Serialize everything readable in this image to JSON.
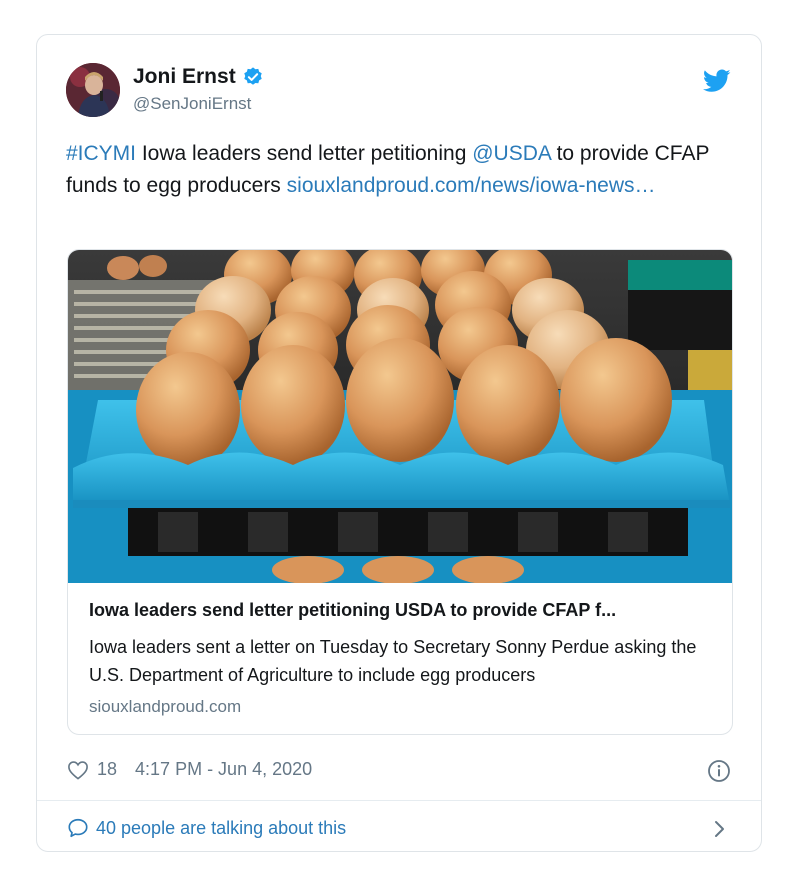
{
  "author": {
    "name": "Joni Ernst",
    "handle": "@SenJoniErnst",
    "verified": true
  },
  "tweet": {
    "parts": [
      {
        "text": "#ICYMI",
        "type": "hashtag"
      },
      {
        "text": " Iowa leaders send letter petitioning ",
        "type": "plain"
      },
      {
        "text": "@USDA",
        "type": "mention"
      },
      {
        "text": " to provide CFAP funds to egg producers ",
        "type": "plain"
      },
      {
        "text": "siouxlandproud.com/news/iowa-news…",
        "type": "url"
      }
    ]
  },
  "card": {
    "title": "Iowa leaders send letter petitioning USDA to provide CFAP f...",
    "description": "Iowa leaders sent a letter on Tuesday to Secretary Sonny Perdue asking the U.S. Department of Agriculture to include egg producers",
    "domain": "siouxlandproud.com",
    "image_icon": "eggs-in-tray-photo"
  },
  "meta": {
    "likes": "18",
    "timestamp": "4:17 PM - Jun 4, 2020"
  },
  "footer": {
    "talking": "40 people are talking about this"
  },
  "icons": {
    "verified": "verified-badge-icon",
    "bird": "twitter-bird-icon",
    "heart": "heart-icon",
    "info": "info-icon",
    "bubble": "speech-bubble-icon",
    "chevron": "chevron-right-icon"
  },
  "colors": {
    "link": "#2b7bb9",
    "secondary_text": "#657786",
    "twitter_blue": "#1da1f2",
    "tray_blue": "#22a7d6"
  }
}
